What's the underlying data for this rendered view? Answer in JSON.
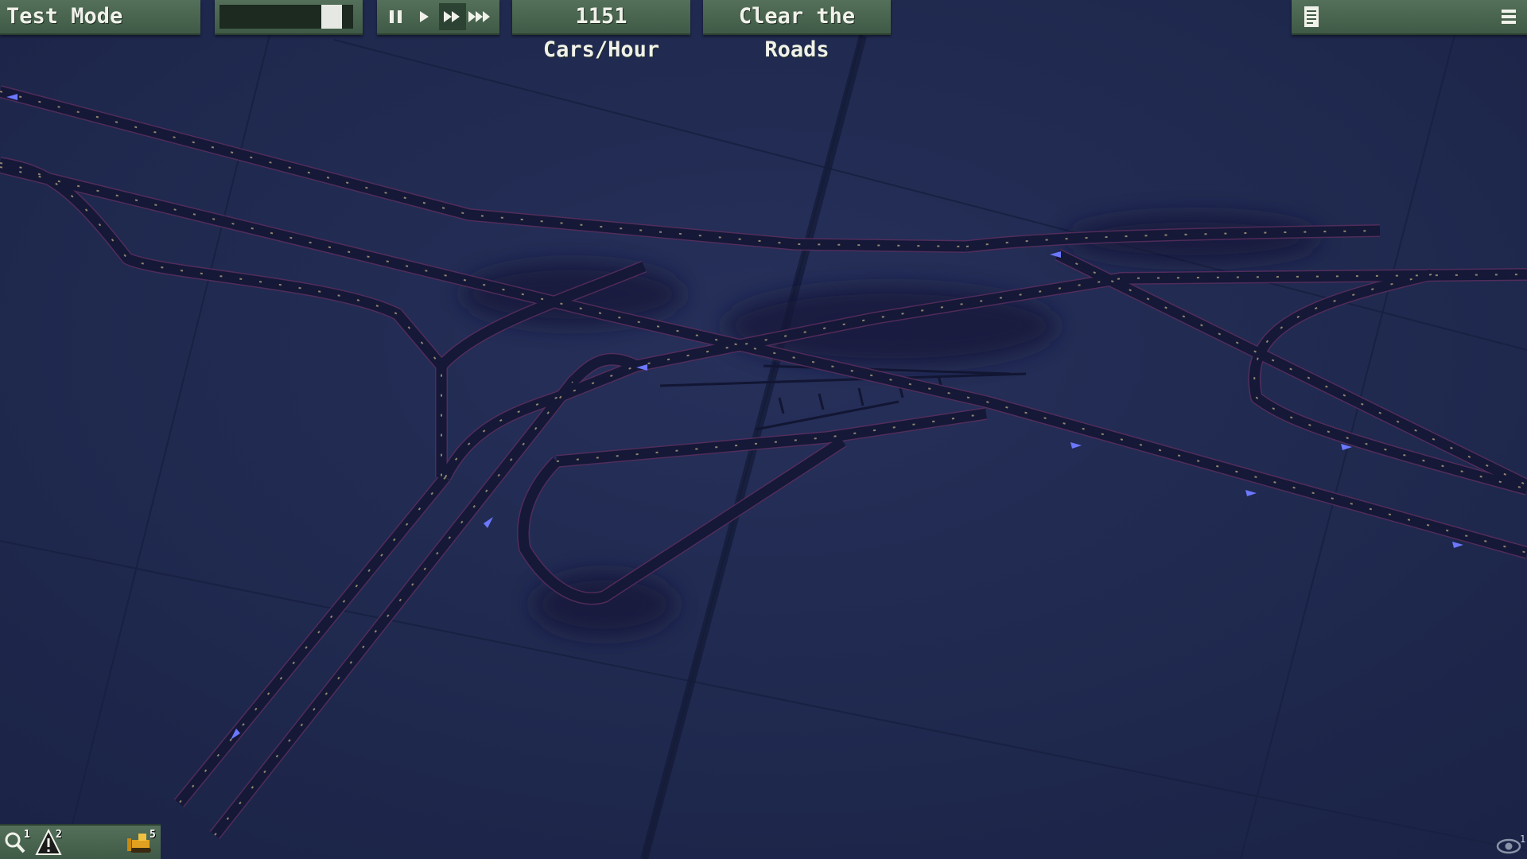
{
  "toolbar": {
    "mode_label": "Test Mode",
    "slider_level": 0.9,
    "speed_buttons": [
      {
        "icon": "pause-icon",
        "active": false
      },
      {
        "icon": "play-icon",
        "active": false
      },
      {
        "icon": "fast-forward-icon",
        "active": true
      },
      {
        "icon": "fastest-forward-icon",
        "active": false
      }
    ],
    "traffic_rate": "1151 Cars/Hour",
    "clear_label": "Clear the Roads",
    "document_icon": "document-icon",
    "menu_icon": "hamburger-menu-icon"
  },
  "bottom_toolbar": {
    "tools": [
      {
        "icon": "magnifier-icon",
        "badge": "1"
      },
      {
        "icon": "warning-cone-icon",
        "badge": "2"
      },
      {
        "icon": "bulldozer-icon",
        "badge": "5"
      }
    ]
  },
  "view": {
    "eye_icon": "eye-icon",
    "eye_badge": "1"
  },
  "colors": {
    "panel_green": "#4a6651",
    "ground": "#1f2a4d",
    "road": "#14173a",
    "road_edge": "#6a3a6a",
    "lane_arrow": "#6c78ff",
    "car_light": "#c8b888"
  }
}
